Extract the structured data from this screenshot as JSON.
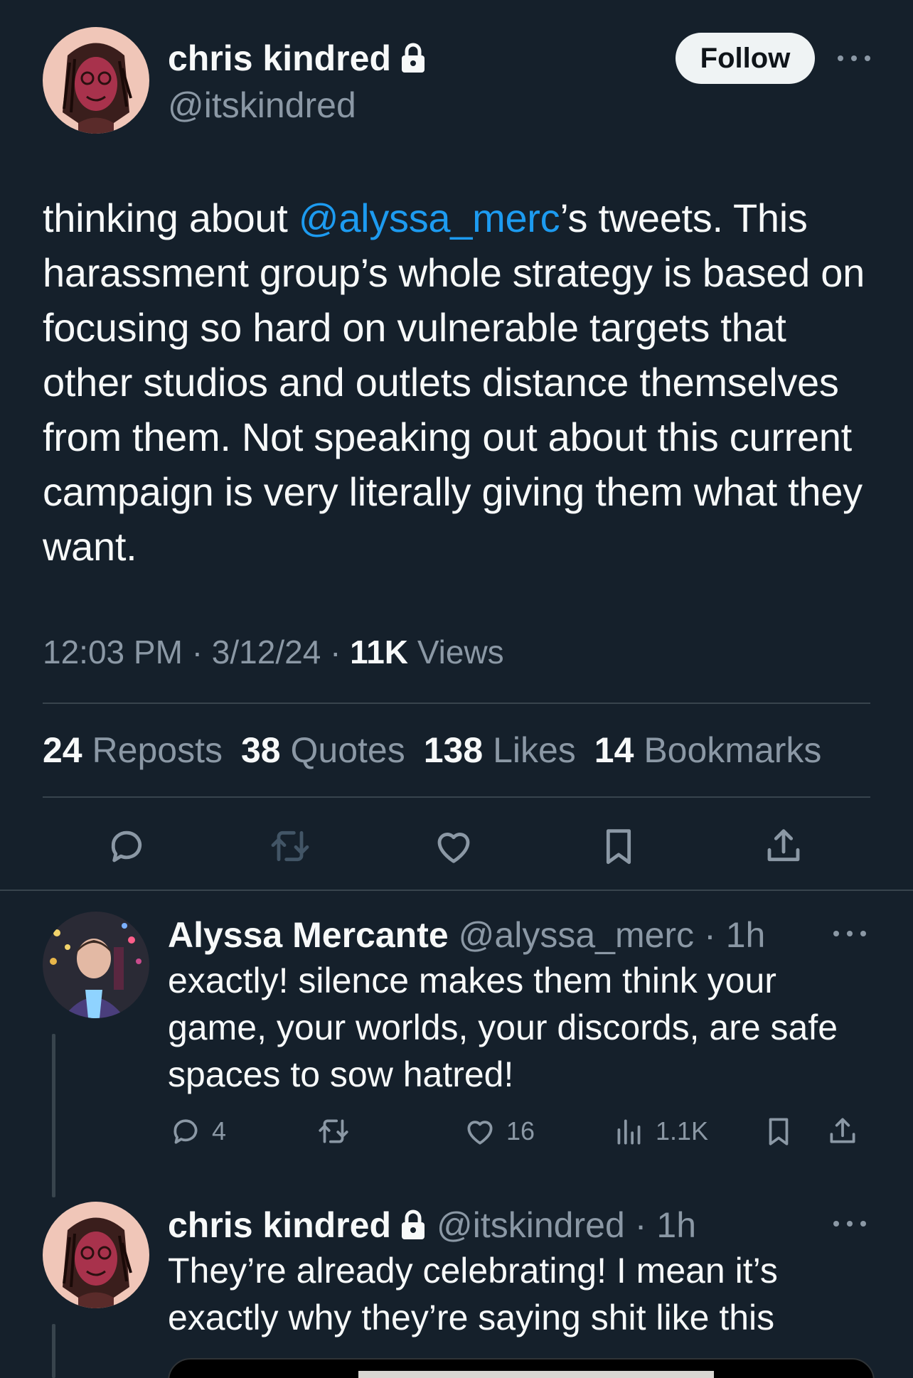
{
  "main_tweet": {
    "author_name": "chris kindred",
    "author_handle": "@itskindred",
    "follow_label": "Follow",
    "text_before": "thinking about ",
    "mention": "@alyssa_merc",
    "text_after": "’s tweets. This harassment group’s whole strategy is based on focusing so hard on vulnerable targets that other studios and outlets distance themselves from them. Not speaking out about this current campaign is very literally giving them what they want.",
    "time": "12:03 PM",
    "date": "3/12/24",
    "views_count": "11K",
    "views_label": "Views",
    "stats": {
      "reposts_count": "24",
      "reposts_label": "Reposts",
      "quotes_count": "38",
      "quotes_label": "Quotes",
      "likes_count": "138",
      "likes_label": "Likes",
      "bookmarks_count": "14",
      "bookmarks_label": "Bookmarks"
    },
    "actions": [
      "reply-icon",
      "repost-icon",
      "like-icon",
      "bookmark-icon",
      "share-icon"
    ]
  },
  "replies": [
    {
      "author_name": "Alyssa Mercante",
      "author_handle": "@alyssa_merc",
      "time": "1h",
      "text": "exactly! silence makes them think your game, your worlds, your discords, are safe spaces to sow hatred!",
      "reply_count": "4",
      "like_count": "16",
      "view_count": "1.1K"
    },
    {
      "author_name": "chris kindred",
      "author_handle": "@itskindred",
      "time": "1h",
      "text": "They’re already celebrating! I mean it’s exactly why they’re saying shit like this"
    }
  ],
  "separator": "·",
  "colors": {
    "background": "#15202b",
    "text": "#f7f9f9",
    "secondary": "#8b98a5",
    "accent": "#1d9bf0",
    "border": "#38444d"
  }
}
